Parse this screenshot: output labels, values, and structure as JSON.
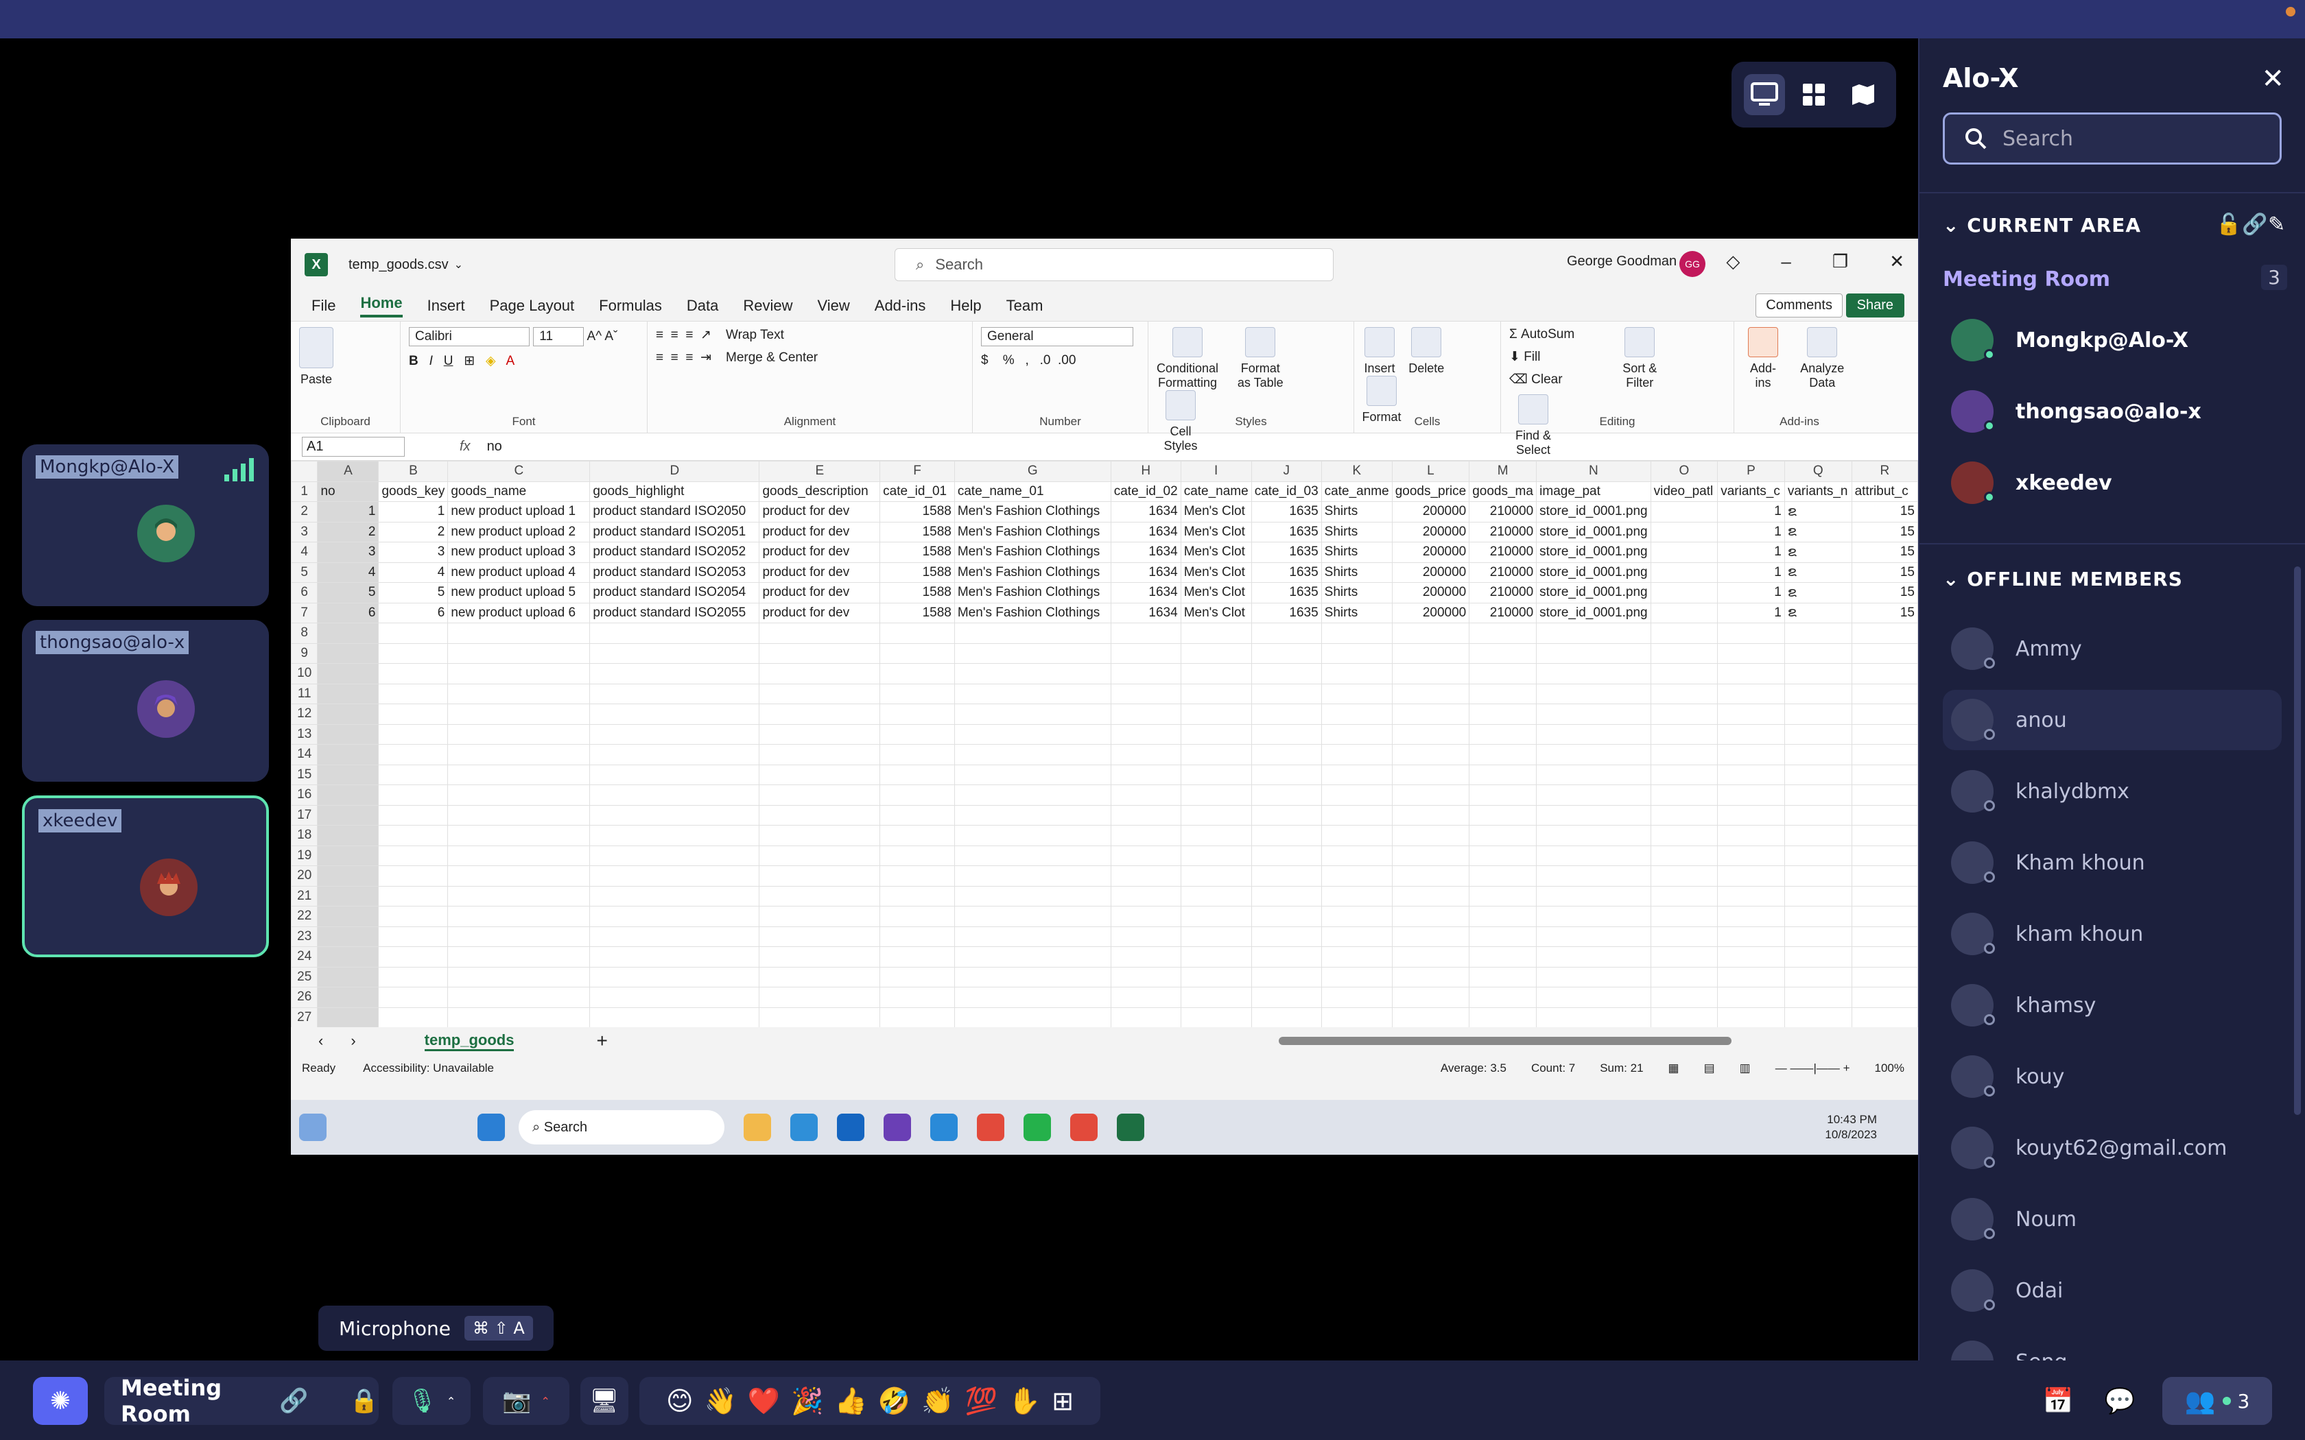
{
  "panel": {
    "title": "Alo-X",
    "search_placeholder": "Search",
    "current_area_label": "CURRENT AREA",
    "room_name": "Meeting Room",
    "room_count": "3",
    "online_members": [
      "Mongkp@Alo-X",
      "thongsao@alo-x",
      "xkeedev"
    ],
    "offline_label": "OFFLINE MEMBERS",
    "offline_members": [
      "Ammy",
      "anou",
      "khalydbmx",
      "Kham khoun",
      "kham khoun",
      "khamsy",
      "kouy",
      "kouyt62@gmail.com",
      "Noum",
      "Odai",
      "Seng"
    ],
    "online_color": "#5ee4b0"
  },
  "tiles": [
    "Mongkp@Alo-X",
    "thongsao@alo-x",
    "xkeedev"
  ],
  "excel": {
    "filename": "temp_goods.csv",
    "search_placeholder": "Search",
    "user_name": "George Goodman",
    "user_initials": "GG",
    "tabs": [
      "File",
      "Home",
      "Insert",
      "Page Layout",
      "Formulas",
      "Data",
      "Review",
      "View",
      "Add-ins",
      "Help",
      "Team"
    ],
    "comments_label": "Comments",
    "share_label": "Share",
    "ribbon": {
      "clipboard": "Clipboard",
      "paste": "Paste",
      "font": "Font",
      "font_name": "Calibri",
      "font_size": "11",
      "alignment": "Alignment",
      "wrap_text": "Wrap Text",
      "merge_center": "Merge & Center",
      "number": "Number",
      "number_format": "General",
      "styles": "Styles",
      "cond_format": "Conditional Formatting",
      "format_table": "Format as Table",
      "cell_styles": "Cell Styles",
      "cells": "Cells",
      "insert": "Insert",
      "delete": "Delete",
      "format": "Format",
      "editing": "Editing",
      "autosum": "AutoSum",
      "fill": "Fill",
      "clear": "Clear",
      "sort_filter": "Sort & Filter",
      "find_select": "Find & Select",
      "addins": "Add-ins",
      "addins_btn": "Add-ins",
      "analyze": "Analyze Data"
    },
    "namebox": "A1",
    "formula": "no",
    "columns": [
      "A",
      "B",
      "C",
      "D",
      "E",
      "F",
      "G",
      "H",
      "I",
      "J",
      "K",
      "L",
      "M",
      "N",
      "O",
      "P",
      "Q",
      "R"
    ],
    "header_row": [
      "no",
      "goods_key",
      "goods_name",
      "goods_highlight",
      "goods_description",
      "cate_id_01",
      "cate_name_01",
      "cate_id_02",
      "cate_name",
      "cate_id_03",
      "cate_anme",
      "goods_price",
      "goods_ma",
      "image_pat",
      "video_patl",
      "variants_c",
      "variants_n",
      "attribut_c"
    ],
    "rows": [
      [
        "1",
        "1",
        "new product upload 1",
        "product standard ISO2050",
        "product for dev",
        "1588",
        "Men's Fashion Clothings",
        "1634",
        "Men's Clot",
        "1635",
        "Shirts",
        "200000",
        "210000",
        "store_id_0001.png",
        "",
        "1",
        "ຂ",
        "15"
      ],
      [
        "2",
        "2",
        "new product upload 2",
        "product standard ISO2051",
        "product for dev",
        "1588",
        "Men's Fashion Clothings",
        "1634",
        "Men's Clot",
        "1635",
        "Shirts",
        "200000",
        "210000",
        "store_id_0001.png",
        "",
        "1",
        "ຂ",
        "15"
      ],
      [
        "3",
        "3",
        "new product upload 3",
        "product standard ISO2052",
        "product for dev",
        "1588",
        "Men's Fashion Clothings",
        "1634",
        "Men's Clot",
        "1635",
        "Shirts",
        "200000",
        "210000",
        "store_id_0001.png",
        "",
        "1",
        "ຂ",
        "15"
      ],
      [
        "4",
        "4",
        "new product upload 4",
        "product standard ISO2053",
        "product for dev",
        "1588",
        "Men's Fashion Clothings",
        "1634",
        "Men's Clot",
        "1635",
        "Shirts",
        "200000",
        "210000",
        "store_id_0001.png",
        "",
        "1",
        "ຂ",
        "15"
      ],
      [
        "5",
        "5",
        "new product upload 5",
        "product standard ISO2054",
        "product for dev",
        "1588",
        "Men's Fashion Clothings",
        "1634",
        "Men's Clot",
        "1635",
        "Shirts",
        "200000",
        "210000",
        "store_id_0001.png",
        "",
        "1",
        "ຂ",
        "15"
      ],
      [
        "6",
        "6",
        "new product upload 6",
        "product standard ISO2055",
        "product for dev",
        "1588",
        "Men's Fashion Clothings",
        "1634",
        "Men's Clot",
        "1635",
        "Shirts",
        "200000",
        "210000",
        "store_id_0001.png",
        "",
        "1",
        "ຂ",
        "15"
      ]
    ],
    "sheet_name": "temp_goods",
    "status_ready": "Ready",
    "status_access": "Accessibility: Unavailable",
    "status_average": "Average: 3.5",
    "status_count": "Count: 7",
    "status_sum": "Sum: 21",
    "zoom": "100%",
    "taskbar_search": "Search",
    "clock_time": "10:43 PM",
    "clock_date": "10/8/2023"
  },
  "bottom": {
    "mic_tooltip": "Microphone",
    "mic_shortcut": "⌘ ⇧ A",
    "room": "Meeting Room",
    "emojis": [
      "😊",
      "👋",
      "❤️",
      "🎉",
      "👍",
      "🤣",
      "👏",
      "💯"
    ],
    "participants": "3"
  }
}
